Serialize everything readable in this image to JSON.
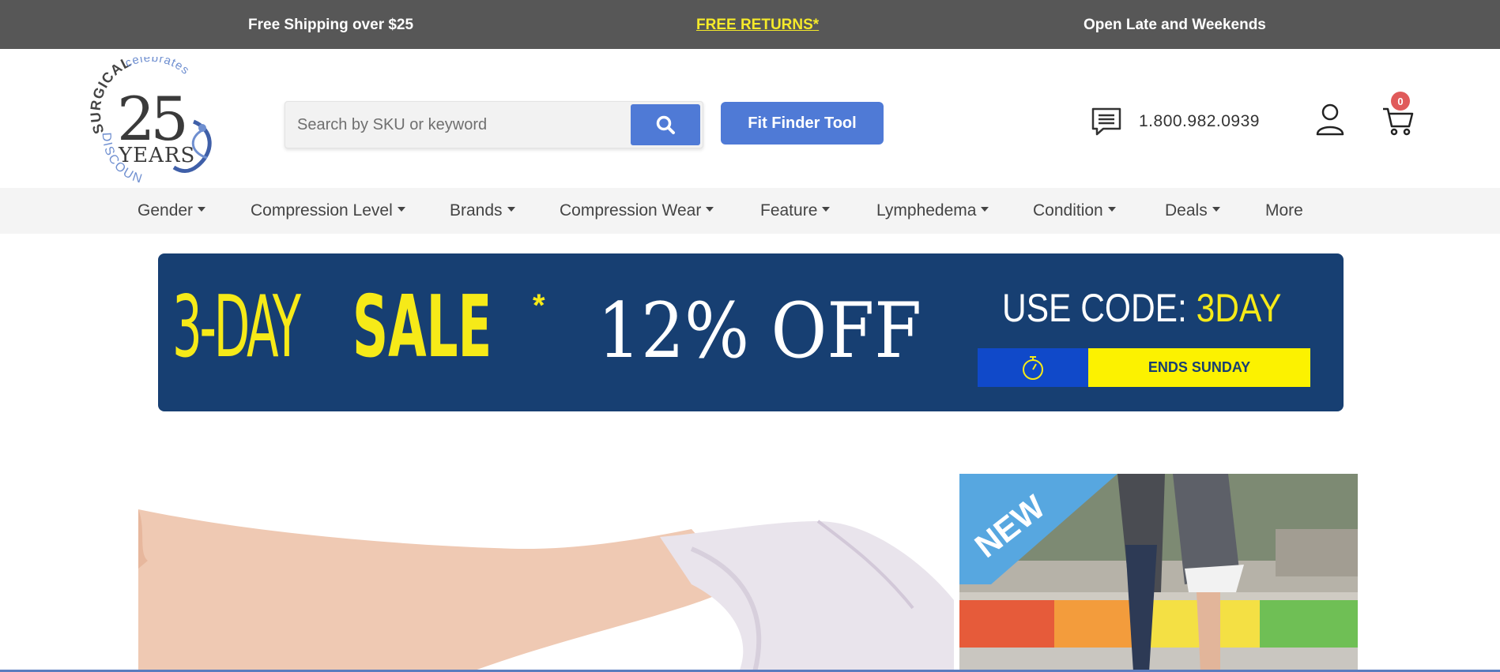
{
  "topbar": {
    "shipping": "Free Shipping over $25",
    "returns": "FREE RETURNS*",
    "hours": "Open Late and Weekends"
  },
  "logo": {
    "brand": "DISCOUNT SURGICAL",
    "celebrates": "celebrates",
    "number": "25",
    "years": "YEARS"
  },
  "search": {
    "placeholder": "Search by SKU or keyword",
    "icon": "search-icon"
  },
  "fit_finder": {
    "label": "Fit Finder Tool"
  },
  "contact": {
    "phone": "1.800.982.0939",
    "chat_icon": "chat-icon"
  },
  "account": {
    "icon": "user-icon"
  },
  "cart": {
    "icon": "cart-icon",
    "count": "0"
  },
  "nav": {
    "items": [
      {
        "label": "Gender",
        "dropdown": true
      },
      {
        "label": "Compression Level",
        "dropdown": true
      },
      {
        "label": "Brands",
        "dropdown": true
      },
      {
        "label": "Compression Wear",
        "dropdown": true
      },
      {
        "label": "Feature",
        "dropdown": true
      },
      {
        "label": "Lymphedema",
        "dropdown": true
      },
      {
        "label": "Condition",
        "dropdown": true
      },
      {
        "label": "Deals",
        "dropdown": true
      },
      {
        "label": "More",
        "dropdown": false
      }
    ]
  },
  "banner": {
    "day": "3-DAY",
    "sale": "SALE",
    "asterisk": "*",
    "discount": "12% OFF",
    "code_label": "USE CODE:",
    "code": "3DAY",
    "timer_icon": "stopwatch-icon",
    "ends": "ENDS SUNDAY"
  },
  "promo": {
    "ribbon": "NEW"
  },
  "colors": {
    "topbar": "#575757",
    "accent_blue": "#4f7ad6",
    "banner_navy": "#173f72",
    "banner_yellow": "#f6ea18",
    "returns_link": "#f5ea2a",
    "cart_badge": "#e05a5a"
  }
}
